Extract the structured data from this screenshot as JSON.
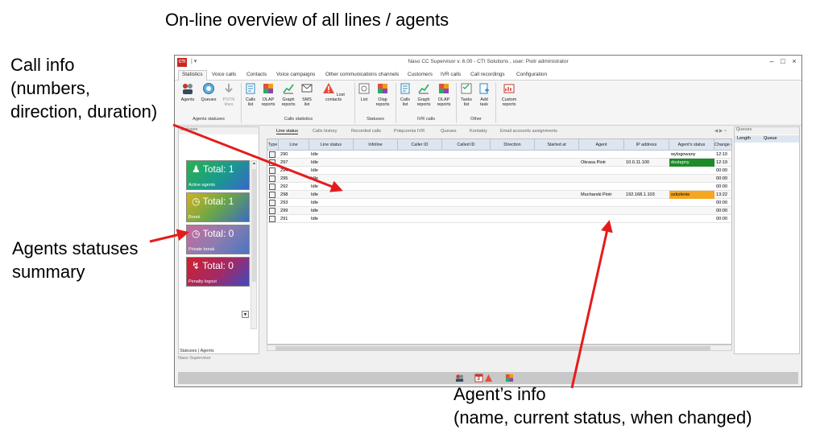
{
  "annotations": {
    "heading": "On-line overview of all lines / agents",
    "call_info": [
      "Call info",
      "(numbers,",
      "direction, duration)"
    ],
    "agents_summary": [
      "Agents statuses",
      "summary"
    ],
    "agent_info": [
      "Agent’s info",
      "(name, current status, when changed)"
    ]
  },
  "window": {
    "title": "Naso CC Supervisor  v. 6.00  -  CTI Solutions ,  user: Piotr administrator",
    "app_icon_text": "CTI",
    "quick_access": "|  ▾",
    "controls": [
      "–",
      "□",
      "×"
    ]
  },
  "menu": {
    "tabs": [
      "Statistics",
      "Voice calls",
      "Contacts",
      "Voice campaigns",
      "Other communications channels",
      "Customers",
      "IVR calls",
      "Call recordings",
      "Configuration"
    ],
    "active": "Statistics"
  },
  "ribbon": {
    "buttons": [
      {
        "label": "Agents",
        "icon": "agents-icon"
      },
      {
        "label": "Queues",
        "icon": "queues-icon"
      },
      {
        "label": "PSTN\nlines",
        "icon": "pstn-lines-icon"
      },
      {
        "label": "Calls\nlist",
        "icon": "calls-list-icon"
      },
      {
        "label": "OLAP\nreports",
        "icon": "olap-reports-icon"
      },
      {
        "label": "Graph\nreports",
        "icon": "graph-reports-icon"
      },
      {
        "label": "SMS\nlist",
        "icon": "sms-list-icon"
      },
      {
        "label": "Lost contacts",
        "icon": "lost-contacts-icon"
      },
      {
        "label": "List",
        "icon": "statuses-list-icon"
      },
      {
        "label": "Olap\nreports",
        "icon": "statuses-olap-icon"
      },
      {
        "label": "Calls\nlist",
        "icon": "ivr-calls-list-icon"
      },
      {
        "label": "Graph\nreports",
        "icon": "ivr-graph-reports-icon"
      },
      {
        "label": "OLAP\nreports",
        "icon": "ivr-olap-reports-icon"
      },
      {
        "label": "Tasks\nlist",
        "icon": "tasks-list-icon"
      },
      {
        "label": "Add\ntask",
        "icon": "add-task-icon"
      },
      {
        "label": "Custom\nreports",
        "icon": "custom-reports-icon"
      }
    ],
    "groups": [
      "Agents statuses",
      "Calls statistics",
      "Statuses",
      "IVR calls",
      "Other"
    ]
  },
  "left_pane": {
    "header": "Statuses",
    "tiles": [
      {
        "total": "Total: 1",
        "label": "Active agents"
      },
      {
        "total": "Total: 1",
        "label": "Break"
      },
      {
        "total": "Total: 0",
        "label": "Private break"
      },
      {
        "total": "Total: 0",
        "label": "Penalty logout"
      }
    ],
    "bottom_tabs": "Statuses | Agents"
  },
  "status_line": "Naso Supervisor",
  "center_tabs": [
    "Line status",
    "Calls history",
    "Recorded calls",
    "Połączenia IVR",
    "Queues",
    "Kontakty",
    "Email accounts assignments"
  ],
  "grid": {
    "columns": [
      "Type",
      "Line",
      "Line status",
      "Infoline",
      "Caller ID",
      "Called ID",
      "Direction",
      "Started at",
      "Agent",
      "IP address",
      "Agent's status",
      "Change at"
    ],
    "rows": [
      {
        "line": "290",
        "status": "Idle",
        "agent": "",
        "ip": "",
        "agent_status": "wylogowany",
        "changed": "12:10",
        "status_color": ""
      },
      {
        "line": "297",
        "status": "Idle",
        "agent": "Okrasa Piotr",
        "ip": "10.0.11.100",
        "agent_status": "dostępny",
        "changed": "12:19",
        "status_color": "#1d8a2a"
      },
      {
        "line": "294",
        "status": "Idle",
        "agent": "",
        "ip": "",
        "agent_status": "",
        "changed": "00:00",
        "status_color": ""
      },
      {
        "line": "295",
        "status": "Idle",
        "agent": "",
        "ip": "",
        "agent_status": "",
        "changed": "00:00",
        "status_color": ""
      },
      {
        "line": "292",
        "status": "Idle",
        "agent": "",
        "ip": "",
        "agent_status": "",
        "changed": "00:00",
        "status_color": ""
      },
      {
        "line": "298",
        "status": "Idle",
        "agent": "Mucharski Piotr",
        "ip": "192.168.1.103",
        "agent_status": "szkolenie",
        "changed": "13:22",
        "status_color": "#f5a623"
      },
      {
        "line": "293",
        "status": "Idle",
        "agent": "",
        "ip": "",
        "agent_status": "",
        "changed": "00:00",
        "status_color": ""
      },
      {
        "line": "299",
        "status": "Idle",
        "agent": "",
        "ip": "",
        "agent_status": "",
        "changed": "00:00",
        "status_color": ""
      },
      {
        "line": "291",
        "status": "Idle",
        "agent": "",
        "ip": "",
        "agent_status": "",
        "changed": "00:00",
        "status_color": ""
      }
    ]
  },
  "right_pane": {
    "header": "Queues",
    "columns": [
      "Length",
      "Queue"
    ]
  },
  "bottom_icons": [
    "agents-icon",
    "calendar-icon",
    "warning-icon",
    "olap-icon"
  ],
  "bottom_icon_badge": "3",
  "colors": {
    "arrow": "#e51c1c",
    "accent_header": "#dde6f0"
  }
}
